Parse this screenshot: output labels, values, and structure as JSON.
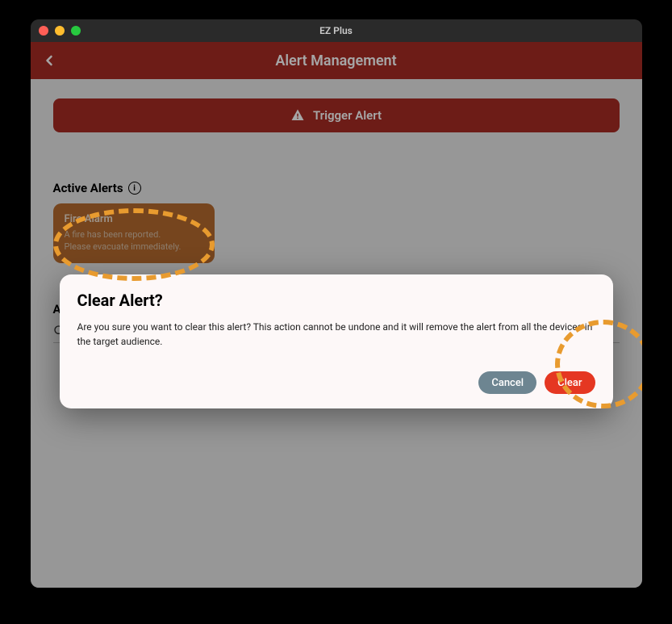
{
  "window": {
    "title": "EZ Plus"
  },
  "header": {
    "title": "Alert Management"
  },
  "trigger_button": {
    "label": "Trigger Alert"
  },
  "active_alerts": {
    "title": "Active Alerts",
    "card": {
      "name": "Fire Alarm",
      "description": "A fire has been reported.\nPlease evacuate immediately."
    }
  },
  "aut_section": {
    "label": "Aut"
  },
  "search": {
    "placeholder": ""
  },
  "dialog": {
    "title": "Clear Alert?",
    "body": "Are you sure you want to clear this alert? This action cannot be undone and it will remove the alert from all the devices in the target audience.",
    "cancel": "Cancel",
    "clear": "Clear"
  },
  "colors": {
    "brand_red": "#a82b24",
    "alert_card": "#b56a2f",
    "btn_cancel": "#6d8591",
    "btn_clear": "#e53722",
    "annotation": "#e89b2f"
  }
}
